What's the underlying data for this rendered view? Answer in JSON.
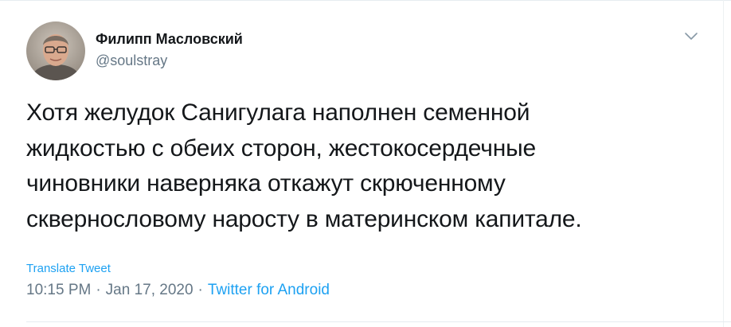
{
  "author": {
    "display_name": "Филипп Масловский",
    "handle": "@soulstray",
    "avatar_icon": "user-photo"
  },
  "tweet": {
    "lines": [
      "Хотя желудок Санигулага наполнен семенной",
      "жидкостью с обеих сторон, жестокосердечные",
      "чиновники наверняка откажут скрюченному",
      "сквернословому наросту в материнском капитале."
    ],
    "translate_label": "Translate Tweet",
    "time": "10:15 PM",
    "separator": "·",
    "date": "Jan 17, 2020",
    "source": "Twitter for Android"
  },
  "menu": {
    "icon": "chevron-down-icon"
  },
  "colors": {
    "text": "#14171a",
    "secondary": "#657786",
    "link": "#1da1f2",
    "border": "#e6ecf0"
  }
}
